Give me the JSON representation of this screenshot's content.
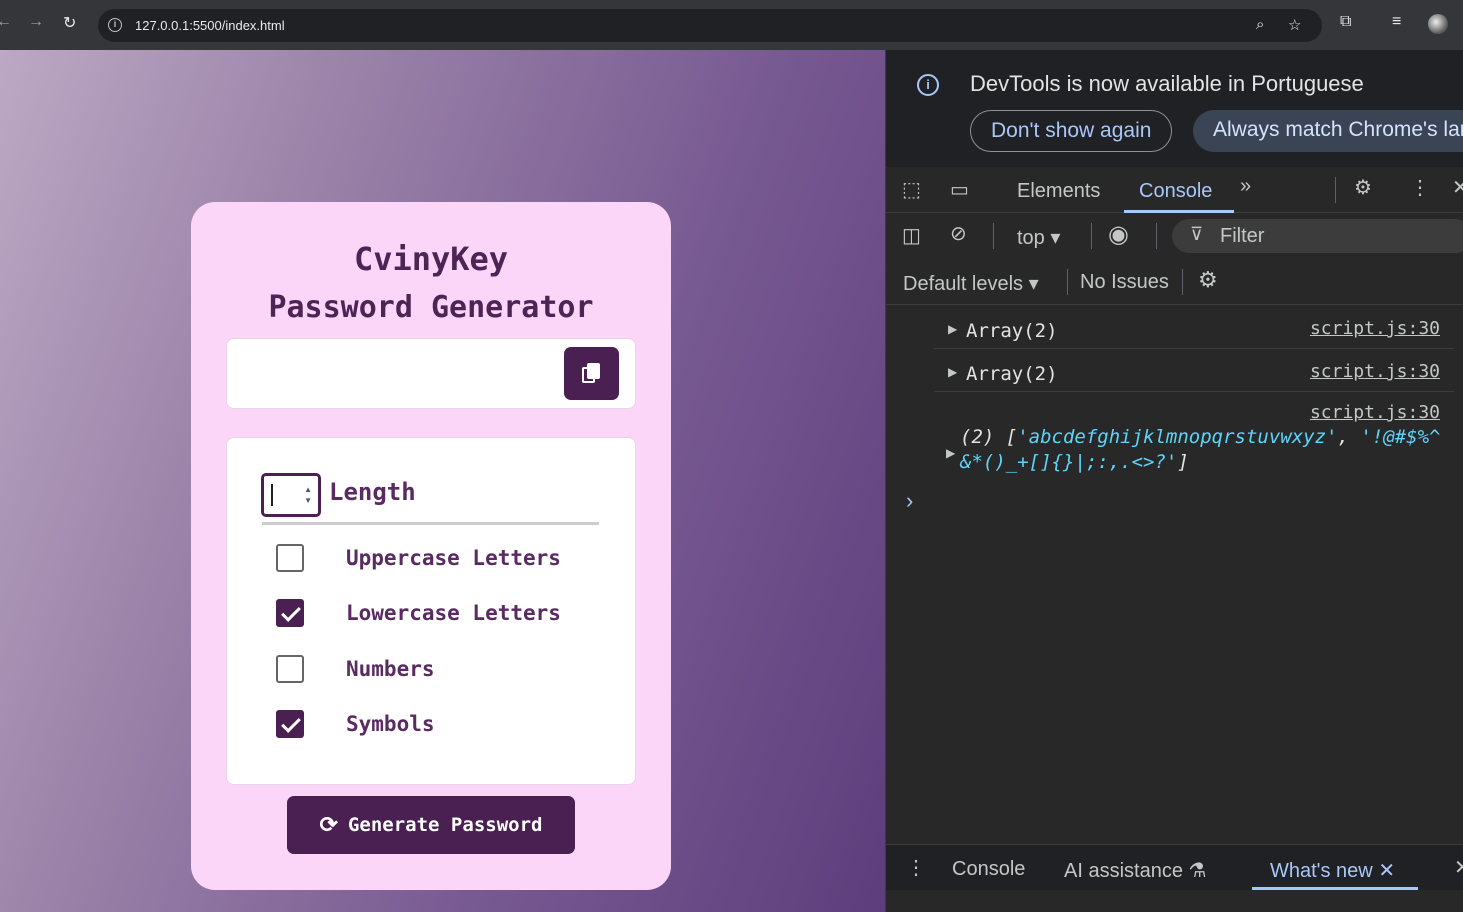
{
  "browser": {
    "url": "127.0.0.1:5500/index.html"
  },
  "page": {
    "title_line1": "CvinyKey",
    "title_line2": "Password Generator",
    "password_value": "",
    "length_value": "",
    "length_label": "Length",
    "options": [
      {
        "label": "Uppercase Letters",
        "checked": false
      },
      {
        "label": "Lowercase Letters",
        "checked": true
      },
      {
        "label": "Numbers",
        "checked": false
      },
      {
        "label": "Symbols",
        "checked": true
      }
    ],
    "generate_label": "Generate Password",
    "accent_color": "#4a1f52",
    "card_color": "#fcd6f8"
  },
  "devtools": {
    "banner_message": "DevTools is now available in Portuguese",
    "dont_show_again": "Don't show again",
    "always_match": "Always match Chrome's lar",
    "tabs": [
      "Elements",
      "Console"
    ],
    "active_tab": "Console",
    "context": "top",
    "filter_placeholder": "Filter",
    "levels": "Default levels",
    "issues": "No Issues",
    "logs": [
      {
        "text": "Array(2)",
        "source": "script.js:30"
      },
      {
        "text": "Array(2)",
        "source": "script.js:30"
      },
      {
        "source": "script.js:30",
        "prefix": "(2) [",
        "str1": "'abcdefghijklmnopqrstuvwxyz'",
        "comma": ", ",
        "str2a": "'!@#$%^",
        "str2b": "&*()_+[]{}|;:,.<>?'",
        "suffix": "]"
      }
    ],
    "drawer_tabs": [
      "Console",
      "AI assistance",
      "What's new"
    ],
    "active_drawer_tab": "What's new"
  }
}
